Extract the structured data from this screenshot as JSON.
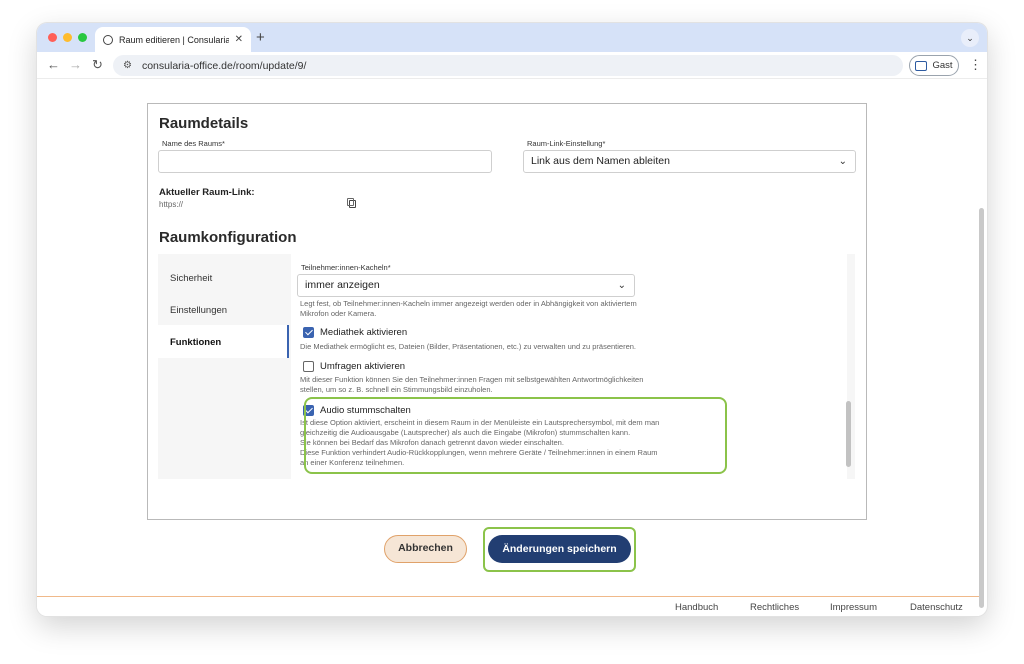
{
  "browser": {
    "tab_title": "Raum editieren | Consularia O",
    "url": "consularia-office.de/room/update/9/",
    "profile_label": "Gast",
    "traffic_lights": [
      "#ff5f57",
      "#febc2e",
      "#28c840"
    ]
  },
  "room_details": {
    "heading": "Raumdetails",
    "name_label": "Name des Raums*",
    "name_value": "",
    "link_setting_label": "Raum-Link-Einstellung*",
    "link_setting_value": "Link aus dem Namen ableiten",
    "current_link_label": "Aktueller Raum-Link:",
    "current_link_value": "https://"
  },
  "room_config": {
    "heading": "Raumkonfiguration",
    "nav": [
      "Sicherheit",
      "Einstellungen",
      "Funktionen"
    ],
    "active_nav": "Funktionen",
    "tiles_label": "Teilnehmer:innen-Kacheln*",
    "tiles_value": "immer anzeigen",
    "tiles_help_1": "Legt fest, ob Teilnehmer:innen-Kacheln immer angezeigt werden oder in Abhängigkeit von aktiviertem",
    "tiles_help_2": "Mikrofon oder Kamera.",
    "options": [
      {
        "label": "Mediathek aktivieren",
        "checked": true,
        "help": [
          "Die Mediathek ermöglicht es, Dateien (Bilder, Präsentationen, etc.) zu verwalten und zu präsentieren."
        ]
      },
      {
        "label": "Umfragen aktivieren",
        "checked": false,
        "help": [
          "Mit dieser Funktion können Sie den Teilnehmer:innen Fragen mit selbstgewählten Antwortmöglichkeiten",
          "stellen, um so z. B. schnell ein Stimmungsbild einzuholen."
        ]
      },
      {
        "label": "Audio stummschalten",
        "checked": true,
        "help": [
          "Ist diese Option aktiviert, erscheint in diesem Raum in der Menüleiste ein Lautsprechersymbol, mit dem man",
          "gleichzeitig die Audioausgabe (Lautsprecher) als auch die Eingabe (Mikrofon) stummschalten kann.",
          "Sie können bei Bedarf das Mikrofon danach getrennt davon wieder einschalten.",
          "Diese Funktion verhindert Audio-Rückkopplungen, wenn mehrere Geräte / Teilnehmer:innen in einem Raum",
          "an einer Konferenz teilnehmen."
        ]
      }
    ]
  },
  "actions": {
    "cancel": "Abbrechen",
    "save": "Änderungen speichern"
  },
  "footer": {
    "links": [
      "Handbuch",
      "Rechtliches",
      "Impressum",
      "Datenschutz"
    ]
  },
  "colors": {
    "accent": "#3a63b0",
    "save_button": "#223e72",
    "highlight": "#8bc34a"
  }
}
